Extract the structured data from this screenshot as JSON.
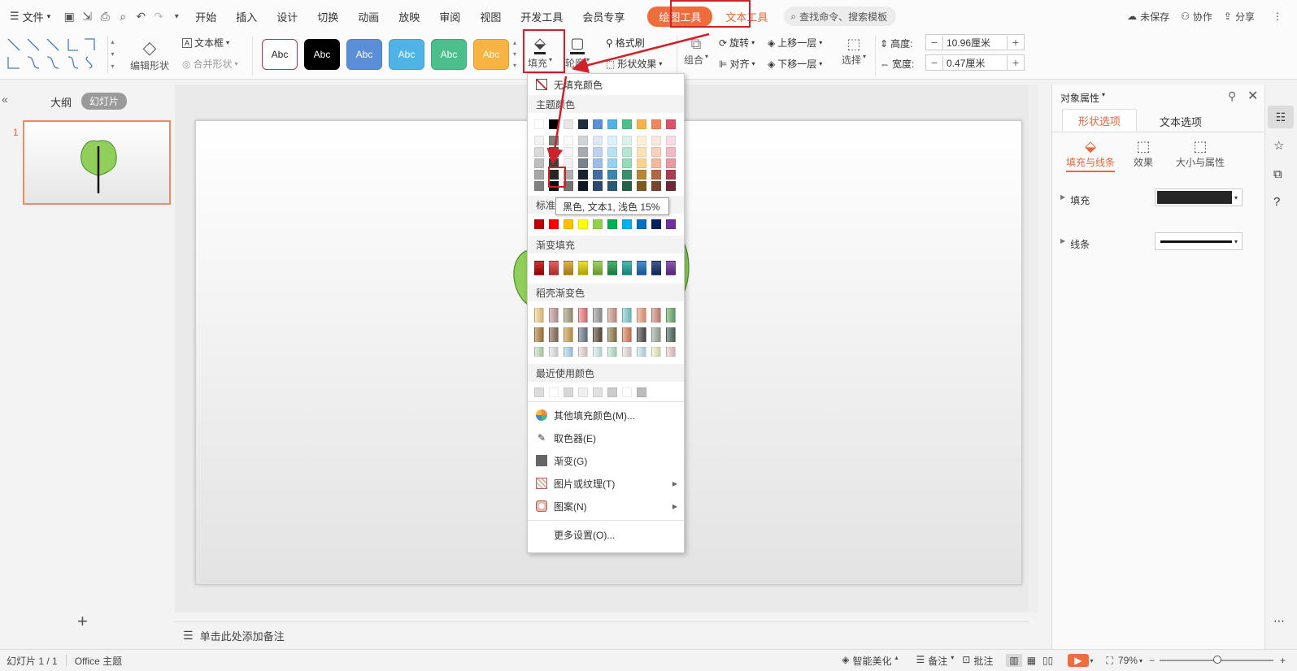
{
  "menubar": {
    "file": "文件",
    "tabs": [
      "开始",
      "插入",
      "设计",
      "切换",
      "动画",
      "放映",
      "审阅",
      "视图",
      "开发工具",
      "会员专享"
    ],
    "drawing_tools": "绘图工具",
    "text_tools": "文本工具",
    "search_placeholder": "查找命令、搜索模板",
    "unsaved": "未保存",
    "collab": "协作",
    "share": "分享"
  },
  "ribbon": {
    "edit_shape": "编辑形状",
    "textbox": "文本框",
    "merge_shape": "合并形状",
    "style_label": "Abc",
    "fill": "填充",
    "outline": "轮廓",
    "format_painter": "格式刷",
    "shape_effects": "形状效果",
    "group": "组合",
    "rotate": "旋转",
    "align": "对齐",
    "bring_forward": "上移一层",
    "send_backward": "下移一层",
    "select": "选择",
    "height_label": "高度:",
    "height_value": "10.96厘米",
    "width_label": "宽度:",
    "width_value": "0.47厘米"
  },
  "styles": [
    {
      "bg": "#ffffff",
      "fg": "#222",
      "border": "#c0304a"
    },
    {
      "bg": "#000000",
      "fg": "#fff",
      "border": "#000"
    },
    {
      "bg": "#5a8fd8",
      "fg": "#fff",
      "border": "#4a7cc0"
    },
    {
      "bg": "#4fb3e6",
      "fg": "#fff",
      "border": "#3fa0d0"
    },
    {
      "bg": "#4cbf8c",
      "fg": "#fff",
      "border": "#3aa878"
    },
    {
      "bg": "#f7b444",
      "fg": "#fff",
      "border": "#e09a2c"
    }
  ],
  "leftpanel": {
    "outline_tab": "大纲",
    "slides_tab": "幻灯片",
    "slide_number": "1"
  },
  "notes": "单击此处添加备注",
  "rightpanel": {
    "title": "对象属性",
    "tab_shape": "形状选项",
    "tab_text": "文本选项",
    "sub_fill_line": "填充与线条",
    "sub_effects": "效果",
    "sub_size": "大小与属性",
    "fill_label": "填充",
    "line_label": "线条"
  },
  "dropdown": {
    "no_fill": "无填充颜色",
    "theme_colors": "主题颜色",
    "standard_colors": "标准色",
    "gradient_fill": "渐变填充",
    "shell_gradient": "稻壳渐变色",
    "recent_colors": "最近使用颜色",
    "more_fill": "其他填充颜色(M)...",
    "eyedropper": "取色器(E)",
    "gradient": "渐变(G)",
    "picture_texture": "图片或纹理(T)",
    "pattern": "图案(N)",
    "more_settings": "更多设置(O)..."
  },
  "tooltip": "黑色, 文本1, 浅色 15%",
  "colors": {
    "theme_top": [
      "#ffffff",
      "#000000",
      "#e7e6e6",
      "#1f2d3d",
      "#5b8fd9",
      "#4fb3e6",
      "#4cbf8c",
      "#f7b444",
      "#f0875c",
      "#e05168"
    ],
    "standard": [
      "#c00000",
      "#ff0000",
      "#ffc000",
      "#ffff00",
      "#92d050",
      "#00b050",
      "#00b0f0",
      "#0070c0",
      "#002060",
      "#7030a0"
    ],
    "gradient": [
      "#c00000",
      "#e03a3a",
      "#d9a020",
      "#e8d800",
      "#8cc63f",
      "#20a050",
      "#20a8a0",
      "#2070c0",
      "#183070",
      "#7030a0"
    ],
    "accent": "#ef6c3c"
  },
  "statusbar": {
    "slide_info": "幻灯片 1 / 1",
    "theme": "Office 主题",
    "smart_beautify": "智能美化",
    "notes": "备注",
    "comments": "批注",
    "zoom": "79%"
  }
}
